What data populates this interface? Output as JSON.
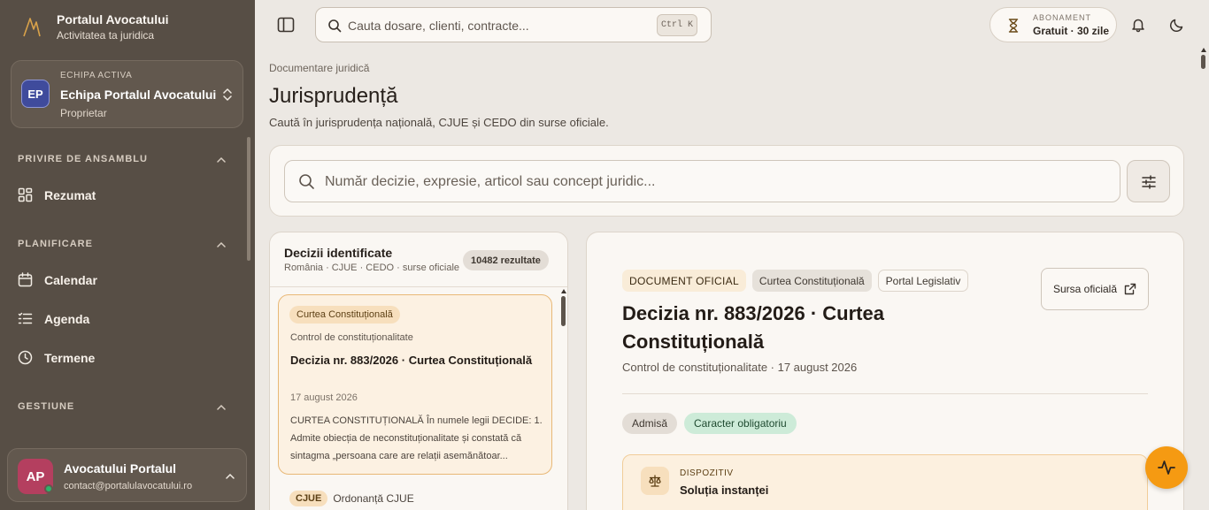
{
  "brand": {
    "title": "Portalul Avocatului",
    "subtitle": "Activitatea ta juridica"
  },
  "team": {
    "label": "ECHIPA ACTIVA",
    "initials": "EP",
    "name": "Echipa Portalul Avocatului",
    "role": "Proprietar"
  },
  "sidebar": {
    "sections": [
      {
        "heading": "PRIVIRE DE ANSAMBLU",
        "items": [
          {
            "label": "Rezumat",
            "icon": "dashboard-grid-icon"
          }
        ]
      },
      {
        "heading": "PLANIFICARE",
        "items": [
          {
            "label": "Calendar",
            "icon": "calendar-icon"
          },
          {
            "label": "Agenda",
            "icon": "list-icon"
          },
          {
            "label": "Termene",
            "icon": "clock-icon"
          }
        ]
      },
      {
        "heading": "GESTIUNE",
        "items": []
      }
    ]
  },
  "user": {
    "initials": "AP",
    "name": "Avocatului Portalul",
    "email": "contact@portalulavocatului.ro"
  },
  "topbar": {
    "search_placeholder": "Cauta dosare, clienti, contracte...",
    "shortcut": "Ctrl K",
    "subscription_label": "ABONAMENT",
    "subscription_value": "Gratuit · 30 zile"
  },
  "page": {
    "breadcrumb": "Documentare juridică",
    "title": "Jurisprudență",
    "subtitle": "Caută în jurisprudența națională, CJUE și CEDO din surse oficiale.",
    "search_placeholder": "Număr decizie, expresie, articol sau concept juridic..."
  },
  "results": {
    "title": "Decizii identificate",
    "subtitle": "România · CJUE · CEDO · surse oficiale",
    "count": "10482 rezultate",
    "items": [
      {
        "court": "Curtea Constituțională",
        "type": "Control de constituționalitate",
        "title": "Decizia nr. 883/2026 · Curtea Constituțională",
        "date": "17 august 2026",
        "snippet": "CURTEA CONSTITUȚIONALĂ În numele legii DECIDE: 1. Admite obiecția de neconstituționalitate și constată că sintagma „persoana care are relații asemănătoar..."
      },
      {
        "court": "CJUE",
        "type": "Ordonanță CJUE"
      }
    ]
  },
  "detail": {
    "chips": [
      "DOCUMENT OFICIAL",
      "Curtea Constituțională",
      "Portal Legislativ"
    ],
    "source_button": "Sursa oficială",
    "title": "Decizia nr. 883/2026 · Curtea Constituțională",
    "meta": "Control de constituționalitate · 17 august 2026",
    "statuses": [
      "Admisă",
      "Caracter obligatoriu"
    ],
    "dispositiv_label": "DISPOZITIV",
    "dispositiv_title": "Soluția instanței"
  },
  "colors": {
    "sidebar": "#574e45",
    "accent": "#f59a12",
    "background": "#ece8e3",
    "selected_card": "#fcf1e2"
  }
}
